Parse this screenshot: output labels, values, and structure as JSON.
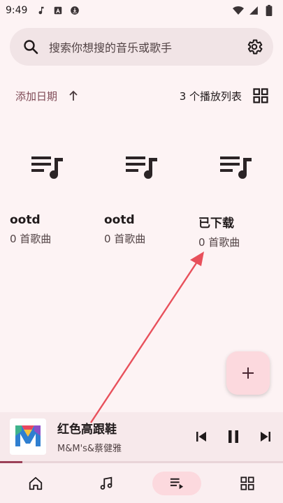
{
  "status": {
    "time": "9:49"
  },
  "search": {
    "placeholder": "搜索你想搜的音乐或歌手"
  },
  "sort": {
    "label": "添加日期",
    "count_text": "3 个播放列表"
  },
  "playlists": [
    {
      "title": "ootd",
      "subtitle": "0 首歌曲"
    },
    {
      "title": "ootd",
      "subtitle": "0 首歌曲"
    },
    {
      "title": "已下载",
      "subtitle": "0 首歌曲"
    }
  ],
  "player": {
    "title": "红色高跟鞋",
    "artist": "M&M's&蔡健雅",
    "progress": 0.08
  },
  "nav": {
    "items": [
      "home-icon",
      "music-note-icon",
      "playlist-icon",
      "grid-icon"
    ],
    "active_index": 2
  },
  "colors": {
    "accent": "#9b4058",
    "background": "#fdf3f4",
    "fab": "#fcd9de",
    "annotation_arrow": "#e8505b"
  }
}
